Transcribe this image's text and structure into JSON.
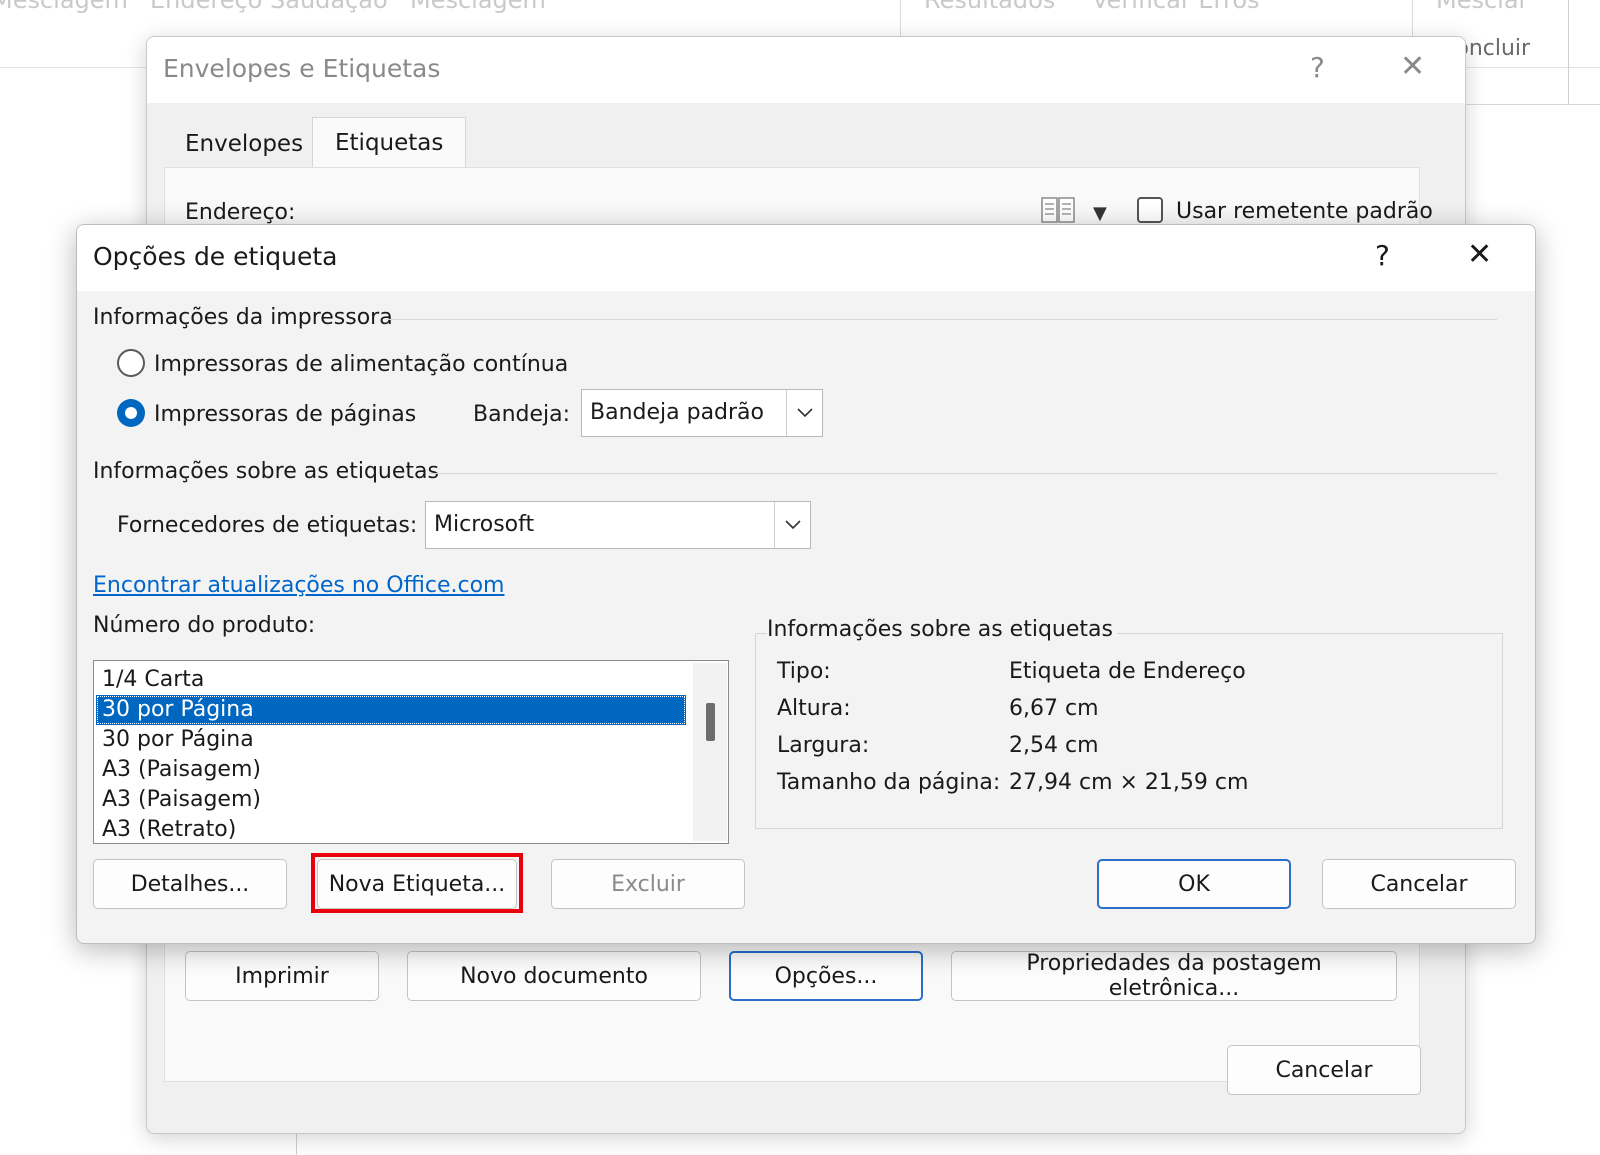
{
  "ribbon": {
    "items": [
      "Mesclagem",
      "Endereço",
      "Saudação",
      "Mesclagem",
      "Resultados",
      "Verificar Erros",
      "Mesclar"
    ],
    "concluir": "Concluir"
  },
  "back_dialog": {
    "title": "Envelopes e Etiquetas",
    "help": "?",
    "close": "✕",
    "tabs": [
      "Envelopes",
      "Etiquetas"
    ],
    "address_label": "Endereço:",
    "use_default_sender": "Usar remetente padrão",
    "buttons": {
      "print": "Imprimir",
      "new_document": "Novo documento",
      "options": "Opções...",
      "eletronic_postage_properties": "Propriedades da postagem eletrônica...",
      "cancel": "Cancelar"
    }
  },
  "dialog": {
    "title": "Opções de etiqueta",
    "help": "?",
    "close": "✕",
    "printer_info": {
      "title": "Informações da impressora",
      "continuous": "Impressoras de alimentação contínua",
      "pages": "Impressoras de páginas",
      "pages_selected": true,
      "tray_label": "Bandeja:",
      "tray_value": "Bandeja padrão"
    },
    "label_info": {
      "title": "Informações sobre as etiquetas",
      "vendor_label": "Fornecedores de etiquetas:",
      "vendor_value": "Microsoft",
      "link": "Encontrar atualizações no Office.com"
    },
    "product": {
      "label": "Número do produto:",
      "items": [
        "1/4 Carta",
        "30 por Página",
        "30 por Página",
        "A3 (Paisagem)",
        "A3 (Paisagem)",
        "A3 (Retrato)"
      ],
      "selected_index": 1
    },
    "details": {
      "title": "Informações sobre as etiquetas",
      "type_label": "Tipo:",
      "type_value": "Etiqueta de Endereço",
      "height_label": "Altura:",
      "height_value": "6,67 cm",
      "width_label": "Largura:",
      "width_value": "2,54 cm",
      "page_label": "Tamanho da página:",
      "page_value": "27,94 cm × 21,59 cm"
    },
    "buttons": {
      "details": "Detalhes...",
      "new_label": "Nova Etiqueta...",
      "delete": "Excluir",
      "ok": "OK",
      "cancel": "Cancelar"
    }
  },
  "colors": {
    "accent": "#0067c0",
    "highlight": "#e8000b",
    "link": "#0066cc"
  }
}
